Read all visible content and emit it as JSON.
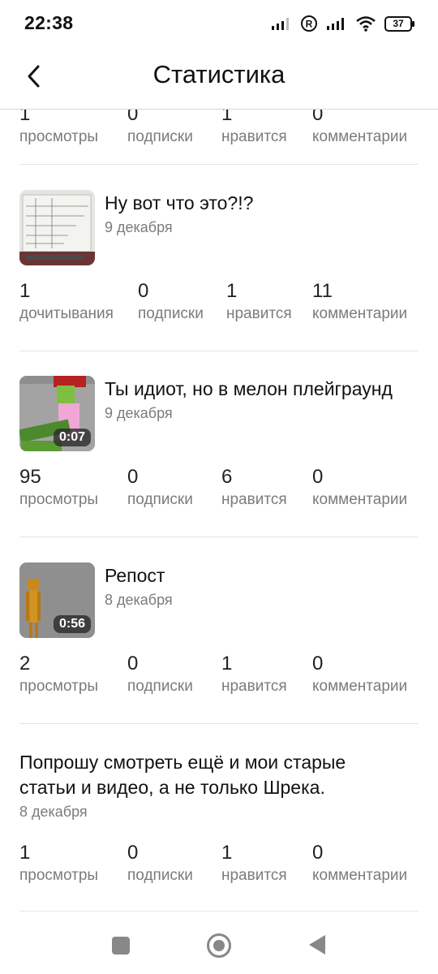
{
  "status_bar": {
    "time": "22:38",
    "battery": "37",
    "icons": [
      "signal-icon",
      "roaming-r-icon",
      "signal-icon",
      "wifi-icon",
      "battery-icon"
    ]
  },
  "header": {
    "title": "Статистика",
    "back_icon": "chevron-left-icon"
  },
  "stat_labels": {
    "views": "просмотры",
    "reads": "дочитывания",
    "subscriptions": "подписки",
    "likes": "нравится",
    "comments": "комментарии"
  },
  "items": [
    {
      "title": "",
      "date": "",
      "stats": [
        {
          "value": "1",
          "label": "просмотры"
        },
        {
          "value": "0",
          "label": "подписки"
        },
        {
          "value": "1",
          "label": "нравится"
        },
        {
          "value": "0",
          "label": "комментарии"
        }
      ]
    },
    {
      "title": "Ну вот что это?!?",
      "date": "9 декабря",
      "thumbnail": "whiteboard-photo",
      "stats": [
        {
          "value": "1",
          "label": "дочитывания"
        },
        {
          "value": "0",
          "label": "подписки"
        },
        {
          "value": "1",
          "label": "нравится"
        },
        {
          "value": "11",
          "label": "комментарии"
        }
      ]
    },
    {
      "title": "Ты идиот, но в мелон плейграунд",
      "date": "9 декабря",
      "duration": "0:07",
      "thumbnail": "melon-playground-video",
      "stats": [
        {
          "value": "95",
          "label": "просмотры"
        },
        {
          "value": "0",
          "label": "подписки"
        },
        {
          "value": "6",
          "label": "нравится"
        },
        {
          "value": "0",
          "label": "комментарии"
        }
      ]
    },
    {
      "title": "Репост",
      "date": "8 декабря",
      "duration": "0:56",
      "thumbnail": "ragdoll-video",
      "stats": [
        {
          "value": "2",
          "label": "просмотры"
        },
        {
          "value": "0",
          "label": "подписки"
        },
        {
          "value": "1",
          "label": "нравится"
        },
        {
          "value": "0",
          "label": "комментарии"
        }
      ]
    },
    {
      "title": "Попрошу смотреть ещё и мои старые статьи и видео, а не только Шрека.",
      "date": "8 декабря",
      "stats": [
        {
          "value": "1",
          "label": "просмотры"
        },
        {
          "value": "0",
          "label": "подписки"
        },
        {
          "value": "1",
          "label": "нравится"
        },
        {
          "value": "0",
          "label": "комментарии"
        }
      ]
    }
  ],
  "nav_bar": {
    "icons": [
      "recents-square-icon",
      "home-circle-icon",
      "back-triangle-icon"
    ]
  }
}
